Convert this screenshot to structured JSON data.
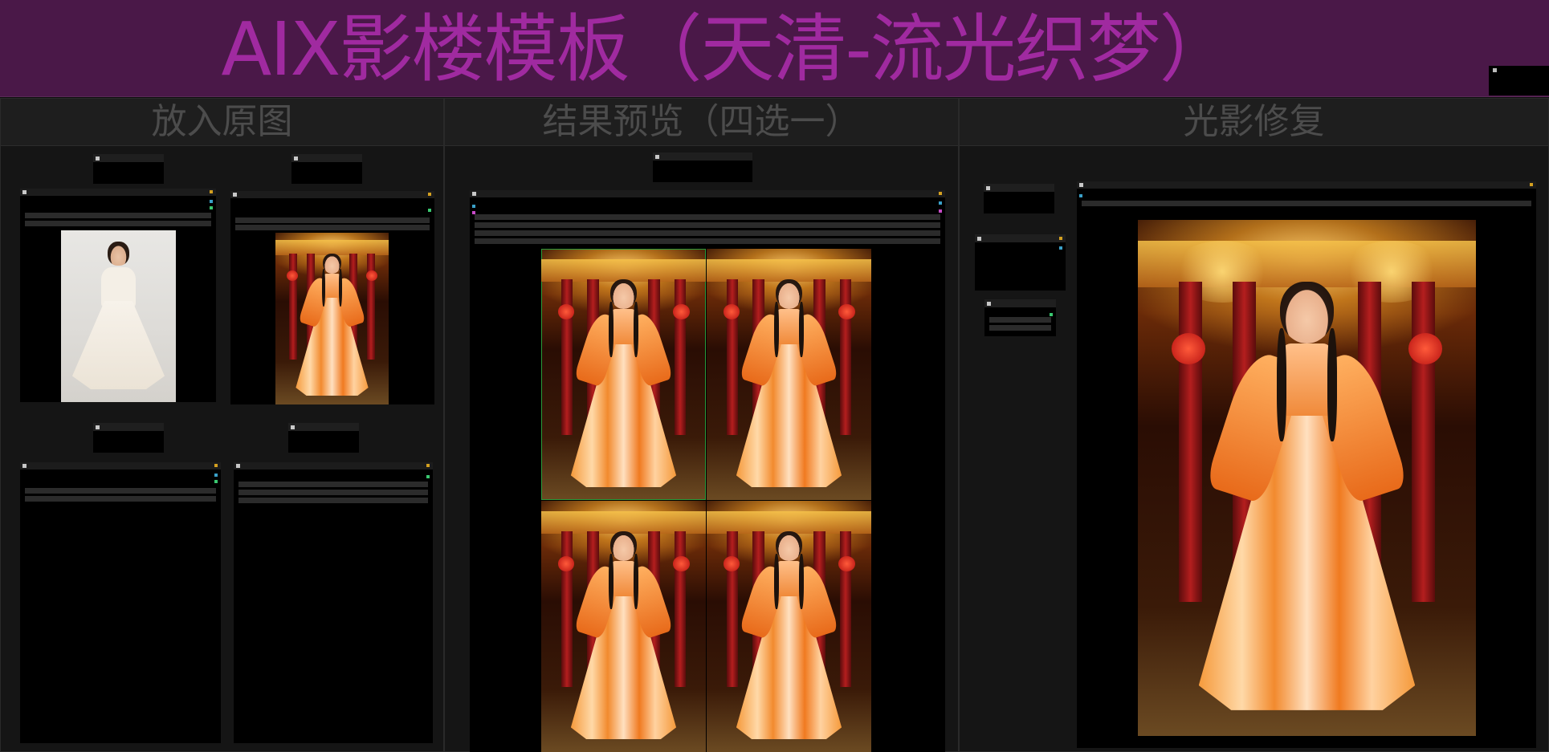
{
  "title": "AIX影楼模板（天清-流光织梦）",
  "groups": [
    {
      "title": "放入原图"
    },
    {
      "title": "结果预览（四选一）"
    },
    {
      "title": "光影修复"
    }
  ],
  "colors": {
    "banner": "#4a1848",
    "title_text": "#a02aa0",
    "group_title": "#4c4c4c",
    "canvas": "#0e0e0e"
  }
}
